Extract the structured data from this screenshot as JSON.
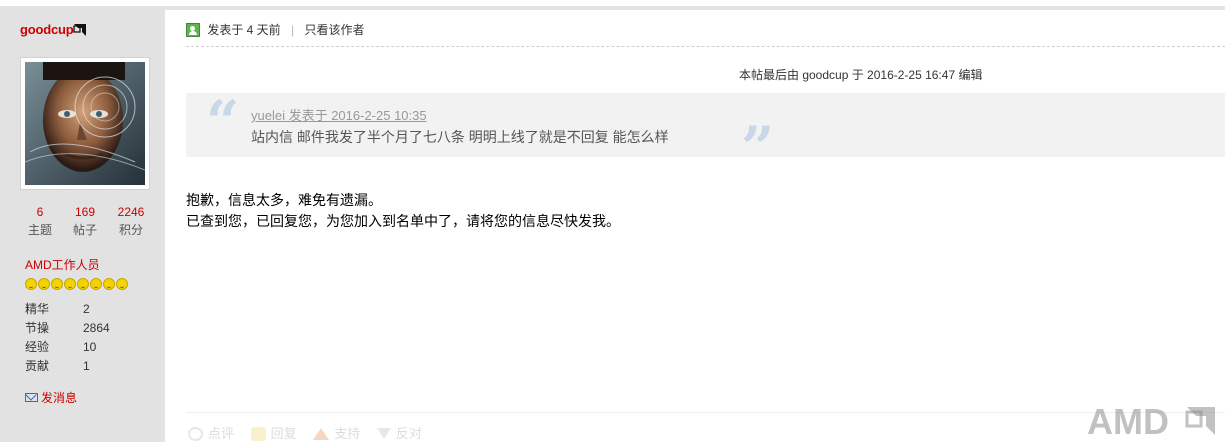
{
  "author": {
    "username": "goodcup",
    "stats": [
      {
        "value": "6",
        "label": "主题"
      },
      {
        "value": "169",
        "label": "帖子"
      },
      {
        "value": "2246",
        "label": "积分"
      }
    ],
    "group": "AMD工作人员",
    "star_count": 8,
    "info": [
      {
        "key": "精华",
        "value": "2"
      },
      {
        "key": "节操",
        "value": "2864"
      },
      {
        "key": "经验",
        "value": "10"
      },
      {
        "key": "贡献",
        "value": "1"
      }
    ],
    "send_message": "发消息"
  },
  "post": {
    "time": "发表于 4 天前",
    "only_author": "只看该作者",
    "edit_note": "本帖最后由 goodcup 于 2016-2-25 16:47 编辑",
    "quote": {
      "meta": "yuelei 发表于 2016-2-25 10:35",
      "text": "站内信 邮件我发了半个月了七八条 明明上线了就是不回复  能怎么样"
    },
    "body_lines": [
      "抱歉，信息太多，难免有遗漏。",
      "已查到您，已回复您，为您加入到名单中了，请将您的信息尽快发我。"
    ],
    "actions": {
      "comment": "点评",
      "reply": "回复",
      "support": "支持",
      "oppose": "反对"
    }
  },
  "watermark": "AMD",
  "colors": {
    "accent_red": "#cc0000",
    "sidebar_bg": "#e2e2e2",
    "quote_bg": "#f2f2f2"
  }
}
